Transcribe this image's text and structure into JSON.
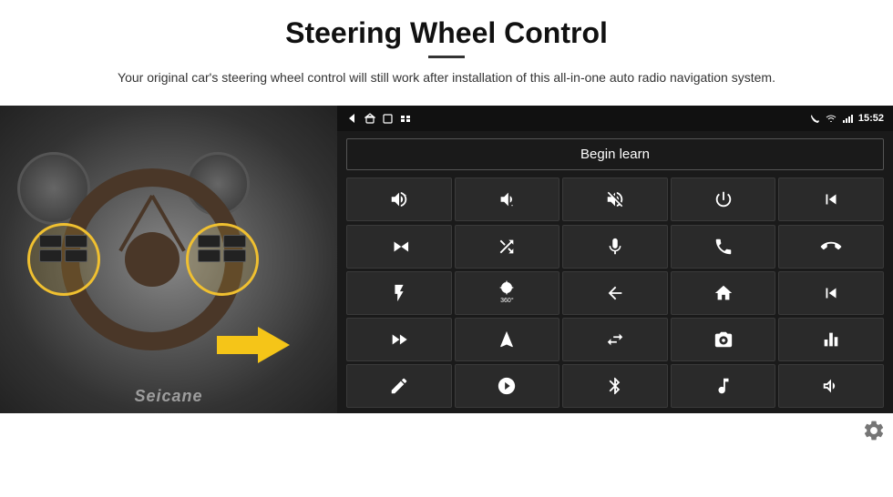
{
  "header": {
    "title": "Steering Wheel Control",
    "subtitle": "Your original car's steering wheel control will still work after installation of this all-in-one auto radio navigation system."
  },
  "statusbar": {
    "time": "15:52",
    "left_icons": [
      "back",
      "home",
      "square",
      "grid"
    ],
    "right_icons": [
      "phone",
      "wifi",
      "signal",
      "time"
    ]
  },
  "begin_learn": {
    "label": "Begin learn"
  },
  "icon_grid": [
    {
      "icon": "vol_up",
      "symbol": "🔊+"
    },
    {
      "icon": "vol_down",
      "symbol": "🔉-"
    },
    {
      "icon": "vol_mute",
      "symbol": "🔇"
    },
    {
      "icon": "power",
      "symbol": "⏻"
    },
    {
      "icon": "prev_track",
      "symbol": "⏮"
    },
    {
      "icon": "skip_next",
      "symbol": "⏭"
    },
    {
      "icon": "shuffle",
      "symbol": "⇌"
    },
    {
      "icon": "mic",
      "symbol": "🎤"
    },
    {
      "icon": "phone",
      "symbol": "📞"
    },
    {
      "icon": "hang_up",
      "symbol": "📵"
    },
    {
      "icon": "flashlight",
      "symbol": "🔦"
    },
    {
      "icon": "view_360",
      "symbol": "360"
    },
    {
      "icon": "back",
      "symbol": "↩"
    },
    {
      "icon": "home",
      "symbol": "🏠"
    },
    {
      "icon": "prev",
      "symbol": "⏮"
    },
    {
      "icon": "skip_fwd",
      "symbol": "⏩"
    },
    {
      "icon": "navigate",
      "symbol": "➤"
    },
    {
      "icon": "swap",
      "symbol": "⇄"
    },
    {
      "icon": "camera",
      "symbol": "📷"
    },
    {
      "icon": "equalizer",
      "symbol": "🎚"
    },
    {
      "icon": "pen",
      "symbol": "✏"
    },
    {
      "icon": "settings_circle",
      "symbol": "⚙"
    },
    {
      "icon": "bluetooth",
      "symbol": "⚡"
    },
    {
      "icon": "music",
      "symbol": "🎵"
    },
    {
      "icon": "waveform",
      "symbol": "📊"
    }
  ],
  "watermark": {
    "text": "Seicane"
  },
  "gear_corner": {
    "symbol": "⚙"
  }
}
